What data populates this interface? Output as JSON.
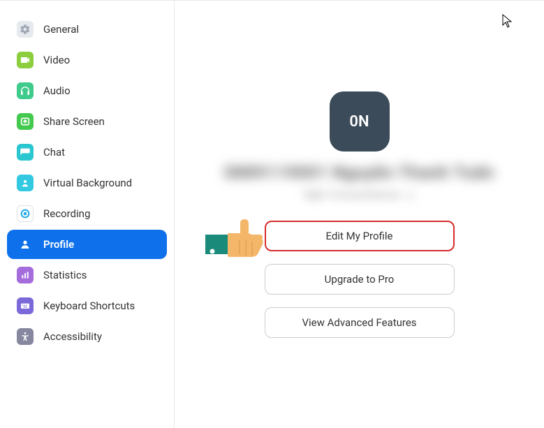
{
  "sidebar": {
    "items": [
      {
        "id": "general",
        "label": "General"
      },
      {
        "id": "video",
        "label": "Video"
      },
      {
        "id": "audio",
        "label": "Audio"
      },
      {
        "id": "share-screen",
        "label": "Share Screen"
      },
      {
        "id": "chat",
        "label": "Chat"
      },
      {
        "id": "virtual-background",
        "label": "Virtual Background"
      },
      {
        "id": "recording",
        "label": "Recording"
      },
      {
        "id": "profile",
        "label": "Profile"
      },
      {
        "id": "statistics",
        "label": "Statistics"
      },
      {
        "id": "keyboard-shortcuts",
        "label": "Keyboard Shortcuts"
      },
      {
        "id": "accessibility",
        "label": "Accessibility"
      }
    ],
    "active": "profile"
  },
  "profile": {
    "avatar_initials": "0N",
    "display_name_obscured": "0889119001 Nguyễn Thanh Tuấn",
    "subtitle_obscured": "0@t Consultation .c",
    "buttons": {
      "edit": "Edit My Profile",
      "upgrade": "Upgrade to Pro",
      "advanced": "View Advanced Features"
    }
  },
  "annotation": {
    "highlight_button": "edit"
  }
}
